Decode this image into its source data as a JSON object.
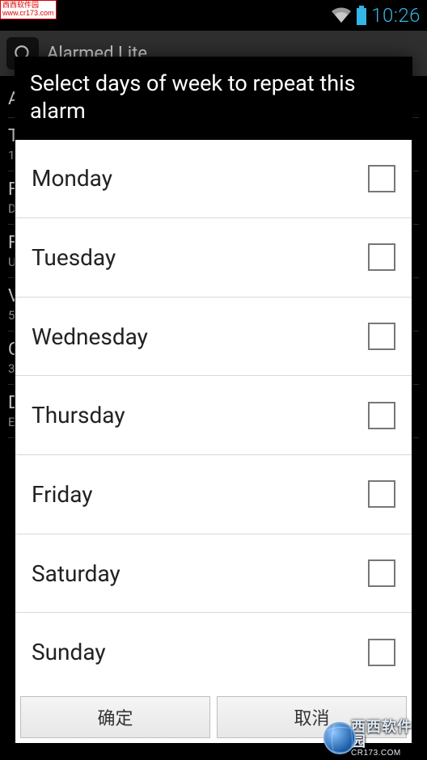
{
  "watermark_top": {
    "line1": "西西软件园",
    "line2": "www.cr173.com"
  },
  "status": {
    "clock": "10:26"
  },
  "app": {
    "title": "Alarmed Lite"
  },
  "bg": {
    "items": [
      {
        "title": "A",
        "sub": ""
      },
      {
        "title": "T",
        "sub": "1"
      },
      {
        "title": "F",
        "sub": "D"
      },
      {
        "title": "F",
        "sub": "U"
      },
      {
        "title": "V",
        "sub": "5"
      },
      {
        "title": "C",
        "sub": "3"
      },
      {
        "title": "D",
        "sub": "E"
      }
    ]
  },
  "dialog": {
    "title": "Select days of week to repeat this alarm",
    "days": [
      {
        "label": "Monday",
        "checked": false
      },
      {
        "label": "Tuesday",
        "checked": false
      },
      {
        "label": "Wednesday",
        "checked": false
      },
      {
        "label": "Thursday",
        "checked": false
      },
      {
        "label": "Friday",
        "checked": false
      },
      {
        "label": "Saturday",
        "checked": false
      },
      {
        "label": "Sunday",
        "checked": false
      }
    ],
    "ok_label": "确定",
    "cancel_label": "取消"
  },
  "watermark_bottom": {
    "line1": "西西软件园",
    "line2": "CR173.COM"
  }
}
